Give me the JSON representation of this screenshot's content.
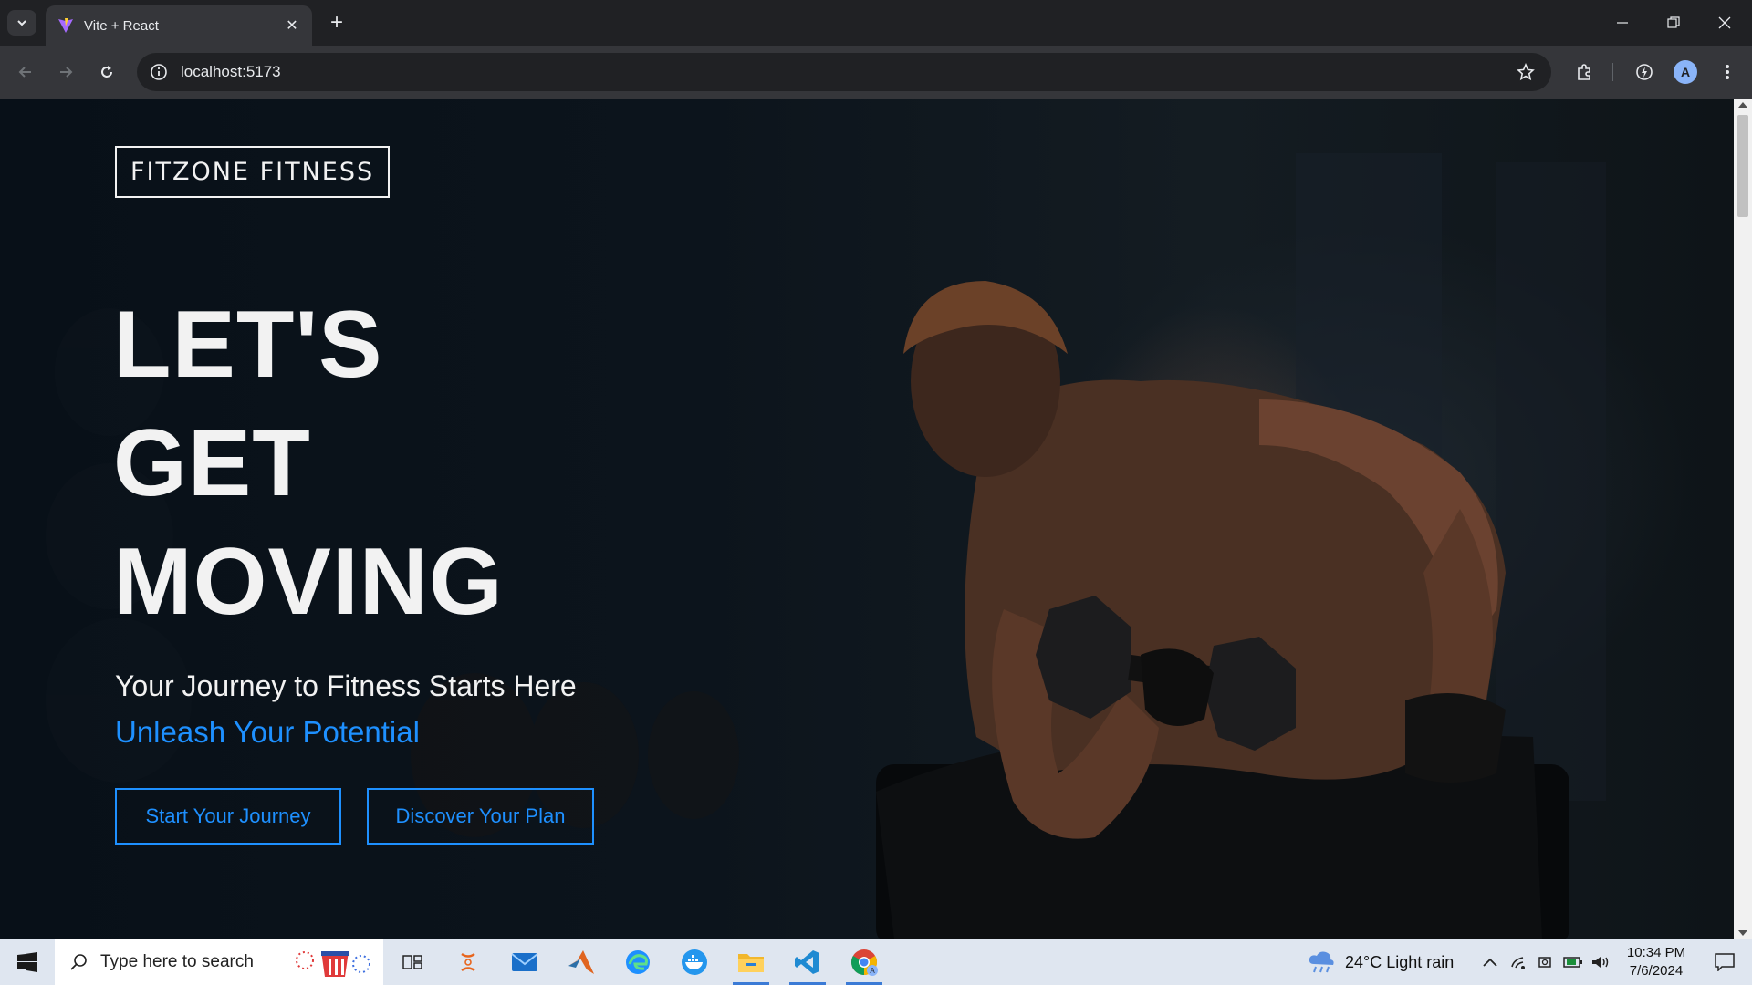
{
  "browser": {
    "tab_title": "Vite + React",
    "url": "localhost:5173",
    "profile_initial": "A"
  },
  "page": {
    "logo": "FITZONE FITNESS",
    "headline": [
      "LET'S",
      "GET",
      "MOVING"
    ],
    "tagline": "Your Journey to Fitness Starts Here",
    "subline": "Unleash Your Potential",
    "buttons": {
      "primary": "Start Your Journey",
      "secondary": "Discover Your Plan"
    },
    "accent_color": "#1e90ff",
    "hero_image": "man-lifting-dumbbell"
  },
  "taskbar": {
    "search_placeholder": "Type here to search",
    "weather": "24°C  Light rain",
    "time": "10:34 PM",
    "date": "7/6/2024"
  }
}
